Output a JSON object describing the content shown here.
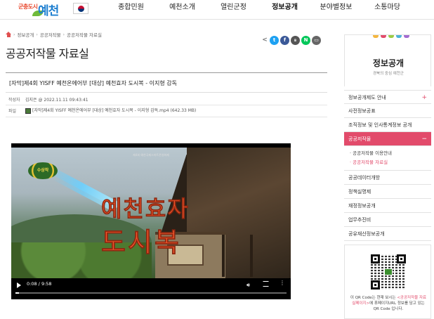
{
  "header": {
    "logo_small": "군충도시",
    "logo_big": "예천",
    "nav": [
      "종합민원",
      "예천소개",
      "열린군정",
      "정보공개",
      "분야별정보",
      "소통마당"
    ],
    "active_nav": "정보공개"
  },
  "breadcrumb": [
    "정보공개",
    "공공저작물",
    "공공저작물 자료실"
  ],
  "page_title": "공공저작물 자료실",
  "share_icons": [
    "share-icon",
    "twitter-icon",
    "facebook-icon",
    "band-icon",
    "naver-icon",
    "print-icon"
  ],
  "post": {
    "title": "[자막]제4회 YISFF 예천온에어부 [대상] 예천효자 도시복 - 이지형 감독",
    "author_label": "작성자",
    "author_value": "김지은 @ 2022.11.11 09:43:41",
    "file_label": "파일",
    "file_value": "[자막]제4회 YISFF 예천온에어부 [대상] 예천효자 도시복 - 이지형 감독.mp4 (642.33 MB)"
  },
  "video": {
    "top_caption": "제4회 예천국제스마트폰영화제",
    "badge": "수상작",
    "title_line1": "예천효자",
    "title_line2": "도시복",
    "current_time": "0:08",
    "duration": "9:58",
    "progress": 0.013
  },
  "sidebar": {
    "title": "정보공개",
    "subtitle": "경북의 중심 예천군",
    "menu": [
      {
        "label": "정보공개제도 안내",
        "plus": "+"
      },
      {
        "label": "사전정보공표",
        "plus": ""
      },
      {
        "label": "조직정보 및 인사통계정보 공개",
        "plus": ""
      },
      {
        "label": "공공저작물",
        "plus": "−",
        "active": true
      },
      {
        "label": "공공데이터개방",
        "plus": ""
      },
      {
        "label": "정책실명제",
        "plus": ""
      },
      {
        "label": "재정정보공개",
        "plus": ""
      },
      {
        "label": "업무추진비",
        "plus": ""
      },
      {
        "label": "공유재산정보공개",
        "plus": ""
      }
    ],
    "submenu": [
      "공공저작물 이용안내",
      "공공저작물 자료실"
    ],
    "qr_text_1": "이 QR Code는 현재 보시는 ",
    "qr_text_hl": "<공공저작물 자료실페이지>",
    "qr_text_2": "에 휴페이지URL 정보를 담고 있는 QR Code 입니다."
  },
  "colors": {
    "accent": "#e24b6b",
    "title_orange": "#f2552a",
    "logo_blue": "#1e7fd0"
  }
}
